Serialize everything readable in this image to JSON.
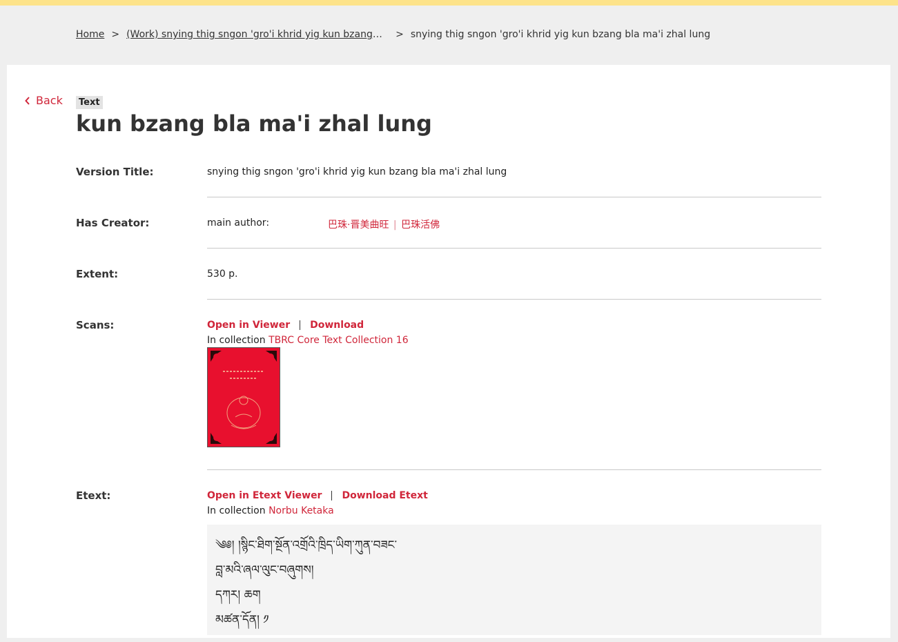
{
  "breadcrumb": {
    "home": "Home",
    "separator": ">",
    "work": "(Work) snying thig sngon 'gro'i khrid yig kun bzang bla ...",
    "current": "snying thig sngon 'gro'i khrid yig kun bzang bla ma'i zhal lung"
  },
  "back_label": "Back",
  "type_badge": "Text",
  "page_title": "kun bzang bla ma'i zhal lung",
  "version_title": {
    "label": "Version Title:",
    "value": "snying thig sngon 'gro'i khrid yig kun bzang bla ma'i zhal lung"
  },
  "creator": {
    "label": "Has Creator:",
    "role": "main author:",
    "name_1": "巴珠·晋美曲旺",
    "name_sep": "|",
    "name_2": "巴珠活佛"
  },
  "extent": {
    "label": "Extent:",
    "value": "530 p."
  },
  "scans": {
    "label": "Scans:",
    "open_viewer": "Open in Viewer",
    "download": "Download",
    "collection_prefix": "In collection",
    "collection_name": "TBRC Core Text Collection 16"
  },
  "etext": {
    "label": "Etext:",
    "open_viewer": "Open in Etext Viewer",
    "download": "Download Etext",
    "collection_prefix": "In collection",
    "collection_name": "Norbu Ketaka",
    "lines": [
      "༄༅། །སྙིང་ཐིག་སྔོན་འགྲོའི་ཁྲིད་ཡིག་ཀུན་བཟང་",
      "བླ་མའི་ཞལ་ལུང་བཞུགས།",
      "དཀར། ཆག",
      "མཚན་དོན། ༡"
    ]
  },
  "colors": {
    "accent": "#d0263a",
    "topbar": "#fde38a",
    "background": "#efefef"
  }
}
